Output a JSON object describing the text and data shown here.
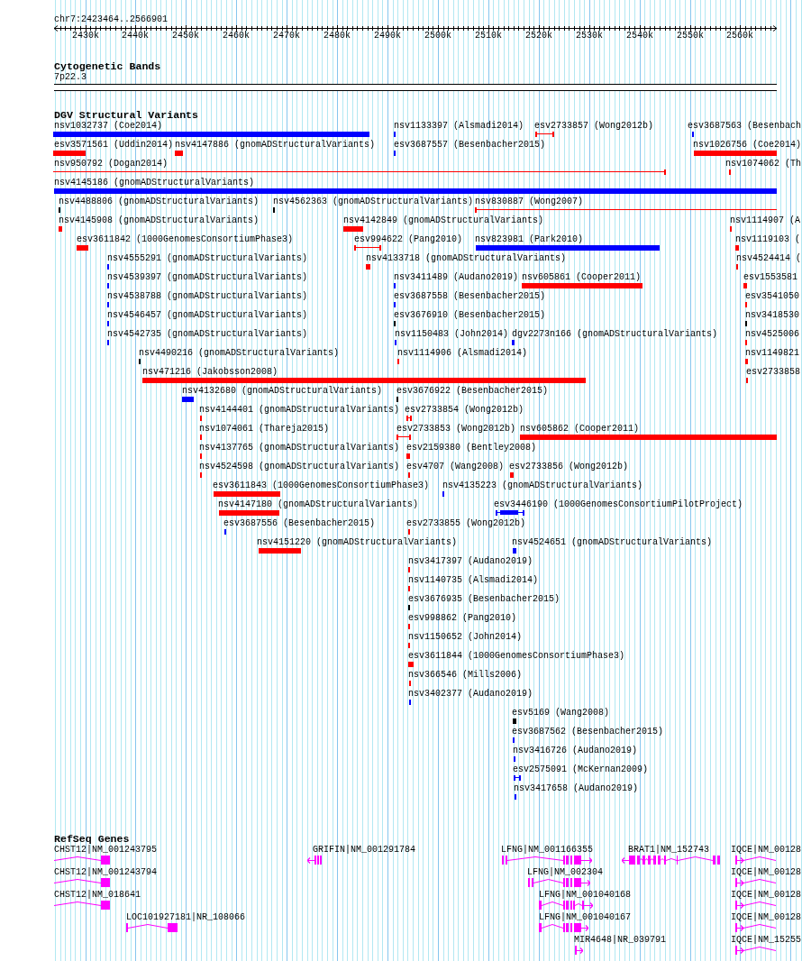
{
  "region": "chr7:2423464..2566901",
  "ruler": {
    "ticks": [
      "2430k",
      "2440k",
      "2450k",
      "2460k",
      "2470k",
      "2480k",
      "2490k",
      "2500k",
      "2510k",
      "2520k",
      "2530k",
      "2540k",
      "2550k",
      "2560k"
    ]
  },
  "cytogenetic_bands": {
    "title": "Cytogenetic Bands",
    "band": "7p22.3"
  },
  "dgv_structural_variants": {
    "title": "DGV Structural Variants",
    "features": [
      {
        "label": "nsv1032737 (Coe2014)",
        "color": "#0000ff",
        "kind": "bar"
      },
      {
        "label": "nsv1133397 (Alsmadi2014)",
        "color": "#0000ff",
        "kind": "bar"
      },
      {
        "label": "esv2733857 (Wong2012b)",
        "color": "#ff0000",
        "kind": "range"
      },
      {
        "label": "esv3687563 (Besenbach",
        "color": "#0000ff",
        "kind": "bar"
      },
      {
        "label": "esv3571561 (Uddin2014)",
        "color": "#ff0000",
        "kind": "bar"
      },
      {
        "label": "nsv4147886 (gnomADStructuralVariants)",
        "color": "#ff0000",
        "kind": "bar"
      },
      {
        "label": "esv3687557 (Besenbacher2015)",
        "color": "#0000ff",
        "kind": "bar"
      },
      {
        "label": "nsv1026756 (Coe2014)",
        "color": "#ff0000",
        "kind": "bar"
      },
      {
        "label": "nsv950792 (Dogan2014)",
        "color": "#ff0000",
        "kind": "range"
      },
      {
        "label": "nsv1074062 (Th",
        "color": "#ff0000",
        "kind": "bar"
      },
      {
        "label": "nsv4145186 (gnomADStructuralVariants)",
        "color": "#0000ff",
        "kind": "bar"
      },
      {
        "label": "nsv4488806 (gnomADStructuralVariants)",
        "color": "#000000",
        "kind": "bar"
      },
      {
        "label": "nsv4562363 (gnomADStructuralVariants)",
        "color": "#000000",
        "kind": "bar"
      },
      {
        "label": "nsv830887 (Wong2007)",
        "color": "#ff0000",
        "kind": "range"
      },
      {
        "label": "nsv4145908 (gnomADStructuralVariants)",
        "color": "#ff0000",
        "kind": "bar"
      },
      {
        "label": "nsv4142849 (gnomADStructuralVariants)",
        "color": "#ff0000",
        "kind": "bar"
      },
      {
        "label": "nsv1114907 (A",
        "color": "#ff0000",
        "kind": "bar"
      },
      {
        "label": "esv3611842 (1000GenomesConsortiumPhase3)",
        "color": "#ff0000",
        "kind": "bar"
      },
      {
        "label": "esv994622 (Pang2010)",
        "color": "#ff0000",
        "kind": "range"
      },
      {
        "label": "nsv823981 (Park2010)",
        "color": "#0000ff",
        "kind": "bar"
      },
      {
        "label": "nsv1119103 (",
        "color": "#ff0000",
        "kind": "bar"
      },
      {
        "label": "nsv4555291 (gnomADStructuralVariants)",
        "color": "#0000ff",
        "kind": "bar"
      },
      {
        "label": "nsv4133718 (gnomADStructuralVariants)",
        "color": "#ff0000",
        "kind": "bar"
      },
      {
        "label": "nsv4524414 (",
        "color": "#ff0000",
        "kind": "bar"
      },
      {
        "label": "nsv4539397 (gnomADStructuralVariants)",
        "color": "#0000ff",
        "kind": "bar"
      },
      {
        "label": "nsv3411489 (Audano2019)",
        "color": "#0000ff",
        "kind": "bar"
      },
      {
        "label": "nsv605861 (Cooper2011)",
        "color": "#ff0000",
        "kind": "bar"
      },
      {
        "label": "esv1553581",
        "color": "#ff0000",
        "kind": "bar"
      },
      {
        "label": "nsv4538788 (gnomADStructuralVariants)",
        "color": "#0000ff",
        "kind": "bar"
      },
      {
        "label": "esv3687558 (Besenbacher2015)",
        "color": "#0000ff",
        "kind": "bar"
      },
      {
        "label": "esv3541050",
        "color": "#ff0000",
        "kind": "bar"
      },
      {
        "label": "nsv4546457 (gnomADStructuralVariants)",
        "color": "#0000ff",
        "kind": "bar"
      },
      {
        "label": "esv3676910 (Besenbacher2015)",
        "color": "#000000",
        "kind": "bar"
      },
      {
        "label": "nsv3418530",
        "color": "#000000",
        "kind": "bar"
      },
      {
        "label": "nsv4542735 (gnomADStructuralVariants)",
        "color": "#0000ff",
        "kind": "bar"
      },
      {
        "label": "nsv1150483 (John2014)",
        "color": "#0000ff",
        "kind": "bar"
      },
      {
        "label": "dgv2273n166 (gnomADStructuralVariants)",
        "color": "#0000ff",
        "kind": "bar"
      },
      {
        "label": "nsv4525006",
        "color": "#ff0000",
        "kind": "bar"
      },
      {
        "label": "nsv4490216 (gnomADStructuralVariants)",
        "color": "#000000",
        "kind": "bar"
      },
      {
        "label": "nsv1114906 (Alsmadi2014)",
        "color": "#ff0000",
        "kind": "bar"
      },
      {
        "label": "nsv1149821",
        "color": "#ff0000",
        "kind": "bar"
      },
      {
        "label": "nsv471216 (Jakobsson2008)",
        "color": "#ff0000",
        "kind": "bar"
      },
      {
        "label": "esv2733858",
        "color": "#ff0000",
        "kind": "bar"
      },
      {
        "label": "nsv4132680 (gnomADStructuralVariants)",
        "color": "#0000ff",
        "kind": "bar"
      },
      {
        "label": "esv3676922 (Besenbacher2015)",
        "color": "#000000",
        "kind": "bar"
      },
      {
        "label": "nsv4144401 (gnomADStructuralVariants)",
        "color": "#ff0000",
        "kind": "bar"
      },
      {
        "label": "esv2733854 (Wong2012b)",
        "color": "#ff0000",
        "kind": "range"
      },
      {
        "label": "nsv1074061 (Thareja2015)",
        "color": "#ff0000",
        "kind": "bar"
      },
      {
        "label": "esv2733853 (Wong2012b)",
        "color": "#ff0000",
        "kind": "range"
      },
      {
        "label": "nsv605862 (Cooper2011)",
        "color": "#ff0000",
        "kind": "bar"
      },
      {
        "label": "nsv4137765 (gnomADStructuralVariants)",
        "color": "#ff0000",
        "kind": "bar"
      },
      {
        "label": "esv2159380 (Bentley2008)",
        "color": "#ff0000",
        "kind": "bar"
      },
      {
        "label": "nsv4524598 (gnomADStructuralVariants)",
        "color": "#ff0000",
        "kind": "bar"
      },
      {
        "label": "esv4707 (Wang2008)",
        "color": "#ff0000",
        "kind": "bar"
      },
      {
        "label": "esv2733856 (Wong2012b)",
        "color": "#ff0000",
        "kind": "range"
      },
      {
        "label": "esv3611843 (1000GenomesConsortiumPhase3)",
        "color": "#ff0000",
        "kind": "bar"
      },
      {
        "label": "nsv4135223 (gnomADStructuralVariants)",
        "color": "#0000ff",
        "kind": "bar"
      },
      {
        "label": "nsv4147180 (gnomADStructuralVariants)",
        "color": "#ff0000",
        "kind": "bar"
      },
      {
        "label": "esv3446190 (1000GenomesConsortiumPilotProject)",
        "color": "#0000ff",
        "kind": "range"
      },
      {
        "label": "esv3687556 (Besenbacher2015)",
        "color": "#0000ff",
        "kind": "bar"
      },
      {
        "label": "esv2733855 (Wong2012b)",
        "color": "#ff0000",
        "kind": "bar"
      },
      {
        "label": "nsv4151220 (gnomADStructuralVariants)",
        "color": "#ff0000",
        "kind": "bar"
      },
      {
        "label": "nsv4524651 (gnomADStructuralVariants)",
        "color": "#0000ff",
        "kind": "bar"
      },
      {
        "label": "nsv3417397 (Audano2019)",
        "color": "#ff0000",
        "kind": "bar"
      },
      {
        "label": "nsv1140735 (Alsmadi2014)",
        "color": "#ff0000",
        "kind": "bar"
      },
      {
        "label": "esv3676935 (Besenbacher2015)",
        "color": "#000000",
        "kind": "bar"
      },
      {
        "label": "esv998862 (Pang2010)",
        "color": "#ff0000",
        "kind": "bar"
      },
      {
        "label": "nsv1150652 (John2014)",
        "color": "#ff0000",
        "kind": "bar"
      },
      {
        "label": "esv3611844 (1000GenomesConsortiumPhase3)",
        "color": "#ff0000",
        "kind": "bar"
      },
      {
        "label": "nsv366546 (Mills2006)",
        "color": "#ff0000",
        "kind": "bar"
      },
      {
        "label": "nsv3402377 (Audano2019)",
        "color": "#0000ff",
        "kind": "bar"
      },
      {
        "label": "esv5169 (Wang2008)",
        "color": "#000000",
        "kind": "bar"
      },
      {
        "label": "esv3687562 (Besenbacher2015)",
        "color": "#0000ff",
        "kind": "bar"
      },
      {
        "label": "nsv3416726 (Audano2019)",
        "color": "#0000ff",
        "kind": "bar"
      },
      {
        "label": "esv2575091 (McKernan2009)",
        "color": "#0000ff",
        "kind": "range"
      },
      {
        "label": "nsv3417658 (Audano2019)",
        "color": "#0000ff",
        "kind": "bar"
      }
    ]
  },
  "refseq_genes": {
    "title": "RefSeq Genes",
    "features": [
      {
        "label": "CHST12|NM_001243795"
      },
      {
        "label": "GRIFIN|NM_001291784",
        "reverse": true
      },
      {
        "label": "LFNG|NM_001166355",
        "reverse": false
      },
      {
        "label": "BRAT1|NM_152743",
        "reverse": true
      },
      {
        "label": "IQCE|NM_00128",
        "reverse": false
      },
      {
        "label": "CHST12|NM_001243794"
      },
      {
        "label": "LFNG|NM_002304",
        "reverse": false
      },
      {
        "label": "IQCE|NM_00128",
        "reverse": false
      },
      {
        "label": "CHST12|NM_018641"
      },
      {
        "label": "LFNG|NM_001040168",
        "reverse": false
      },
      {
        "label": "IQCE|NM_00128",
        "reverse": false
      },
      {
        "label": "LOC101927181|NR_108066"
      },
      {
        "label": "LFNG|NM_001040167",
        "reverse": false
      },
      {
        "label": "IQCE|NM_00128",
        "reverse": false
      },
      {
        "label": "MIR4648|NR_039791",
        "reverse": false
      },
      {
        "label": "IQCE|NM_15255",
        "reverse": false
      }
    ]
  }
}
